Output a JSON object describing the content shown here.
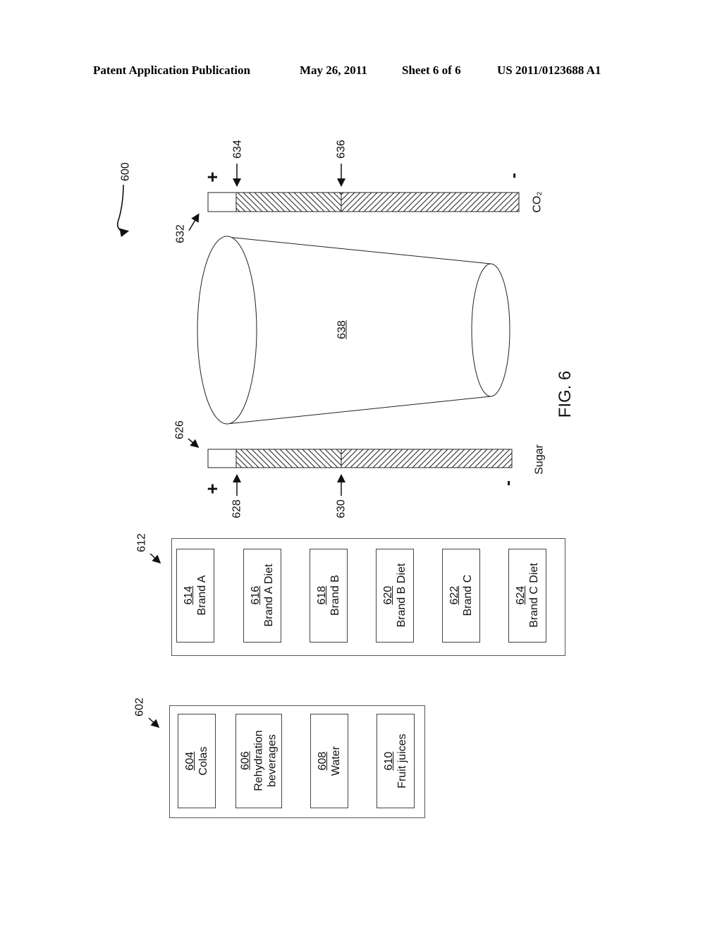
{
  "header": {
    "publication": "Patent Application Publication",
    "date": "May 26, 2011",
    "sheet": "Sheet 6 of 6",
    "number": "US 2011/0123688 A1"
  },
  "figure": {
    "caption": "FIG. 6",
    "ref": "600"
  },
  "co2_bar": {
    "ref": "632",
    "label": "CO₂",
    "plus": "+",
    "minus": "-",
    "marker_a": "634",
    "marker_b": "636"
  },
  "sugar_bar": {
    "ref": "626",
    "label": "Sugar",
    "plus": "+",
    "minus": "-",
    "marker_a": "628",
    "marker_b": "630"
  },
  "cup": {
    "ref": "638"
  },
  "brands": {
    "ref": "612",
    "items": [
      {
        "num": "614",
        "label": "Brand A"
      },
      {
        "num": "616",
        "label": "Brand A Diet"
      },
      {
        "num": "618",
        "label": "Brand B"
      },
      {
        "num": "620",
        "label": "Brand B Diet"
      },
      {
        "num": "622",
        "label": "Brand C"
      },
      {
        "num": "624",
        "label": "Brand C Diet"
      }
    ]
  },
  "categories": {
    "ref": "602",
    "items": [
      {
        "num": "604",
        "label": "Colas"
      },
      {
        "num": "606",
        "label": "Rehydration",
        "label2": "beverages"
      },
      {
        "num": "608",
        "label": "Water"
      },
      {
        "num": "610",
        "label": "Fruit juices"
      }
    ]
  }
}
